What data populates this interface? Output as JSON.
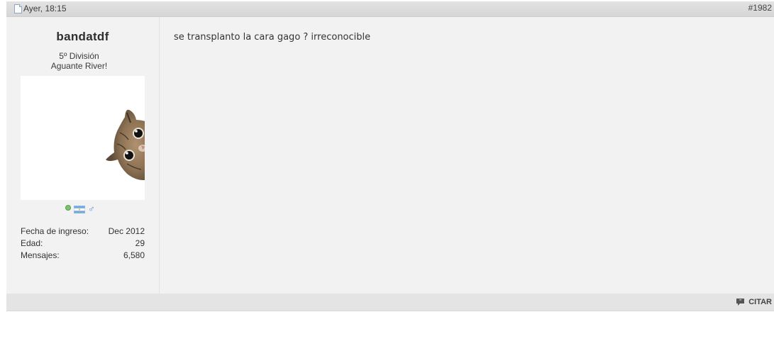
{
  "post": {
    "date": "Ayer, 18:15",
    "number": "#1982",
    "user": {
      "username": "bandatdf",
      "title_line1": "5º División",
      "title_line2": "Aguante River!",
      "avatar_icon": "cat-peeking-avatar",
      "status_icons": [
        "online-icon",
        "argentina-flag-icon",
        "male-icon"
      ],
      "stats": [
        {
          "label": "Fecha de ingreso:",
          "value": "Dec 2012"
        },
        {
          "label": "Edad:",
          "value": "29"
        },
        {
          "label": "Mensajes:",
          "value": "6,580"
        }
      ]
    },
    "message": "se transplanto la cara gago ? irreconocible",
    "quote_label": "CITAR",
    "gender_glyph": "♂"
  },
  "colors": {
    "header_bg": "#d9d9d9",
    "body_bg": "#f2f2f2",
    "footer_bg": "#e4e4e4",
    "online": "#7ac46a",
    "gender": "#5a8fc8"
  }
}
